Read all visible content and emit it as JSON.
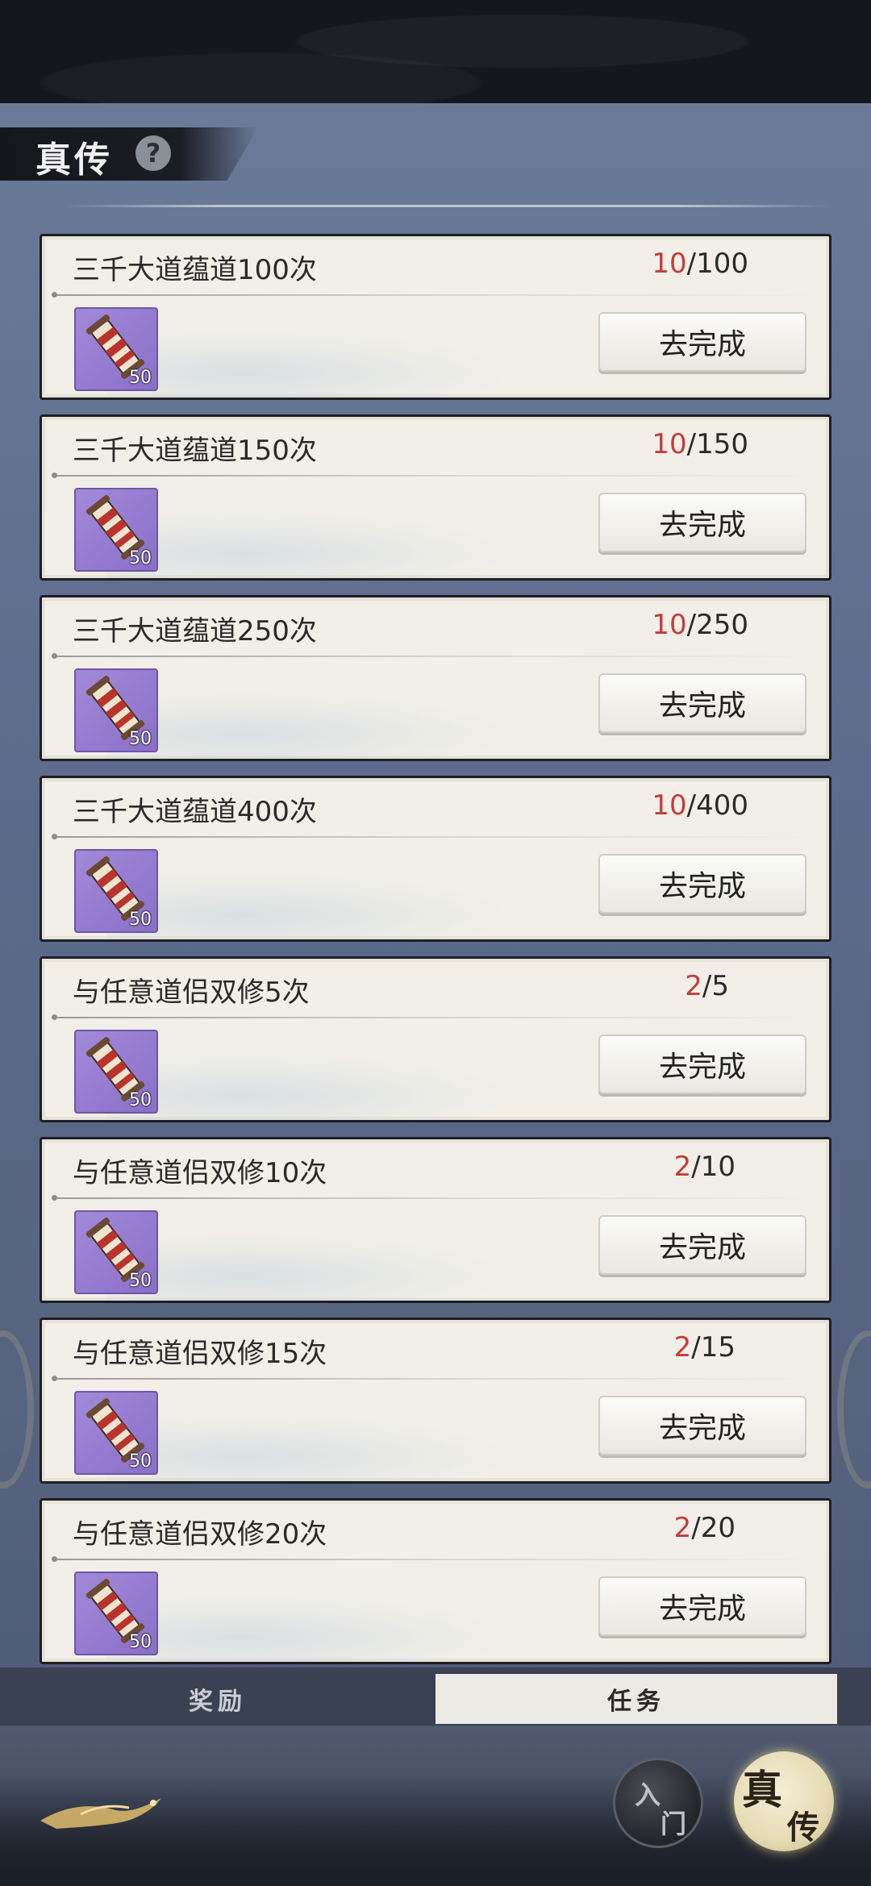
{
  "header": {
    "title": "真传",
    "help_symbol": "?"
  },
  "tasks": [
    {
      "title": "三千大道蕴道100次",
      "current": "10",
      "total": "/100",
      "reward_count": "50",
      "button": "去完成"
    },
    {
      "title": "三千大道蕴道150次",
      "current": "10",
      "total": "/150",
      "reward_count": "50",
      "button": "去完成"
    },
    {
      "title": "三千大道蕴道250次",
      "current": "10",
      "total": "/250",
      "reward_count": "50",
      "button": "去完成"
    },
    {
      "title": "三千大道蕴道400次",
      "current": "10",
      "total": "/400",
      "reward_count": "50",
      "button": "去完成"
    },
    {
      "title": "与任意道侣双修5次",
      "current": "2",
      "total": "/5",
      "reward_count": "50",
      "button": "去完成"
    },
    {
      "title": "与任意道侣双修10次",
      "current": "2",
      "total": "/10",
      "reward_count": "50",
      "button": "去完成"
    },
    {
      "title": "与任意道侣双修15次",
      "current": "2",
      "total": "/15",
      "reward_count": "50",
      "button": "去完成"
    },
    {
      "title": "与任意道侣双修20次",
      "current": "2",
      "total": "/20",
      "reward_count": "50",
      "button": "去完成"
    }
  ],
  "tabs": {
    "rewards": "奖励",
    "tasks": "任务",
    "active": "tasks"
  },
  "nav": {
    "rumen_char1": "入",
    "rumen_char2": "门",
    "zhenchuan_char1": "真",
    "zhenchuan_char2": "传"
  },
  "colors": {
    "progress_current": "#c53b3b",
    "reward_frame": "#8a6fc8",
    "card_bg": "#f1efe8"
  },
  "icons": {
    "reward": "scroll-icon",
    "help": "question-icon"
  }
}
